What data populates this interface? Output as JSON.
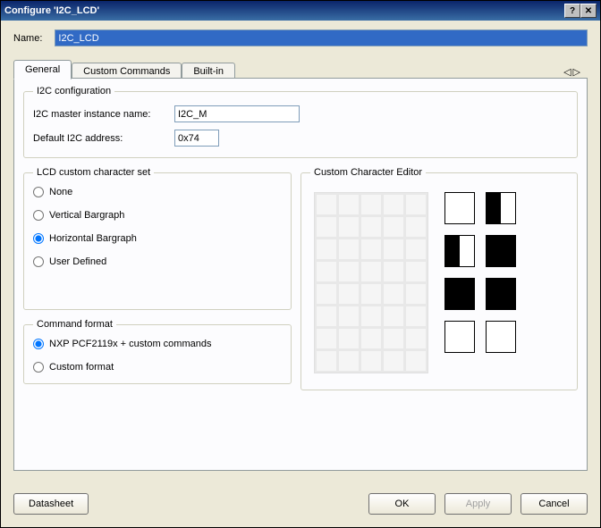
{
  "window": {
    "title": "Configure 'I2C_LCD'"
  },
  "name_field": {
    "label": "Name:",
    "value": "I2C_LCD"
  },
  "tabs": {
    "items": [
      {
        "label": "General"
      },
      {
        "label": "Custom Commands"
      },
      {
        "label": "Built-in"
      }
    ],
    "active_index": 0,
    "nav_left": "◁",
    "nav_right": "▷"
  },
  "i2c_config": {
    "legend": "I2C configuration",
    "master_label": "I2C master instance name:",
    "master_value": "I2C_M",
    "addr_label": "Default I2C address:",
    "addr_value": "0x74"
  },
  "charset": {
    "legend": "LCD custom character set",
    "options": [
      {
        "label": "None"
      },
      {
        "label": "Vertical Bargraph"
      },
      {
        "label": "Horizontal Bargraph"
      },
      {
        "label": "User Defined"
      }
    ],
    "selected_index": 2
  },
  "cmdformat": {
    "legend": "Command format",
    "options": [
      {
        "label": "NXP PCF2119x + custom commands"
      },
      {
        "label": "Custom format"
      }
    ],
    "selected_index": 0
  },
  "char_editor": {
    "legend": "Custom Character Editor",
    "grid": {
      "cols": 5,
      "rows": 8
    },
    "small_chars": [
      {
        "left": false,
        "right": false
      },
      {
        "left": true,
        "right": false
      },
      {
        "left": true,
        "right": false
      },
      {
        "left": true,
        "right": true
      },
      {
        "left": true,
        "right": true
      },
      {
        "left": true,
        "right": true
      },
      {
        "left": false,
        "right": false
      },
      {
        "left": false,
        "right": false
      }
    ]
  },
  "buttons": {
    "datasheet": "Datasheet",
    "ok": "OK",
    "apply": "Apply",
    "cancel": "Cancel"
  },
  "titlebar_icons": {
    "help": "?",
    "close": "✕"
  }
}
